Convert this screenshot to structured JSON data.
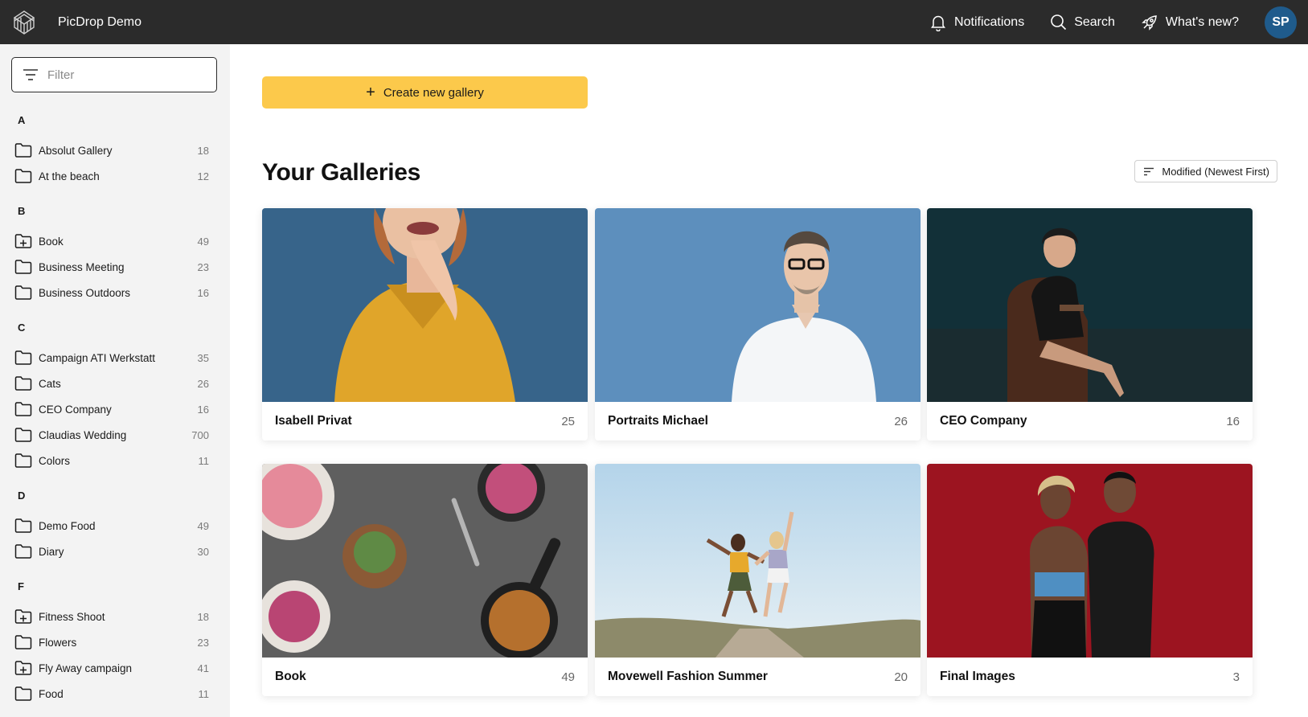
{
  "header": {
    "app_title": "PicDrop Demo",
    "notifications_label": "Notifications",
    "search_label": "Search",
    "whats_new_label": "What's new?",
    "avatar_initials": "SP"
  },
  "sidebar": {
    "filter_placeholder": "Filter",
    "sections": [
      {
        "letter": "A",
        "items": [
          {
            "label": "Absolut Gallery",
            "count": "18",
            "icon": "folder-icon"
          },
          {
            "label": "At the beach",
            "count": "12",
            "icon": "folder-icon"
          }
        ]
      },
      {
        "letter": "B",
        "items": [
          {
            "label": "Book",
            "count": "49",
            "icon": "folder-plus-icon"
          },
          {
            "label": "Business Meeting",
            "count": "23",
            "icon": "folder-icon"
          },
          {
            "label": "Business Outdoors",
            "count": "16",
            "icon": "folder-icon"
          }
        ]
      },
      {
        "letter": "C",
        "items": [
          {
            "label": "Campaign ATI Werkstatt",
            "count": "35",
            "icon": "folder-icon"
          },
          {
            "label": "Cats",
            "count": "26",
            "icon": "folder-icon"
          },
          {
            "label": "CEO Company",
            "count": "16",
            "icon": "folder-icon"
          },
          {
            "label": "Claudias Wedding",
            "count": "700",
            "icon": "folder-icon"
          },
          {
            "label": "Colors",
            "count": "11",
            "icon": "folder-icon"
          }
        ]
      },
      {
        "letter": "D",
        "items": [
          {
            "label": "Demo Food",
            "count": "49",
            "icon": "folder-icon"
          },
          {
            "label": "Diary",
            "count": "30",
            "icon": "folder-icon"
          }
        ]
      },
      {
        "letter": "F",
        "items": [
          {
            "label": "Fitness Shoot",
            "count": "18",
            "icon": "folder-plus-icon"
          },
          {
            "label": "Flowers",
            "count": "23",
            "icon": "folder-icon"
          },
          {
            "label": "Fly Away campaign",
            "count": "41",
            "icon": "folder-plus-icon"
          },
          {
            "label": "Food",
            "count": "11",
            "icon": "folder-icon"
          }
        ]
      }
    ]
  },
  "main": {
    "create_button_label": "Create new gallery",
    "page_title": "Your Galleries",
    "sort_label": "Modified (Newest First)",
    "galleries": [
      {
        "title": "Isabell Privat",
        "count": "25",
        "image": "woman-yellow-shirt-laughing-photo"
      },
      {
        "title": "Portraits Michael",
        "count": "26",
        "image": "man-white-shirt-portrait-photo"
      },
      {
        "title": "CEO Company",
        "count": "16",
        "image": "businesswoman-armchair-photo"
      },
      {
        "title": "Book",
        "count": "49",
        "image": "food-table-flatlay-photo"
      },
      {
        "title": "Movewell Fashion Summer",
        "count": "20",
        "image": "two-women-jumping-photo"
      },
      {
        "title": "Final Images",
        "count": "3",
        "image": "athletes-red-background-photo"
      }
    ]
  },
  "colors": {
    "topbar": "#2b2b2b",
    "sidebar": "#f3f3f3",
    "accent_yellow": "#fcc94b",
    "avatar": "#1f5b8c"
  }
}
